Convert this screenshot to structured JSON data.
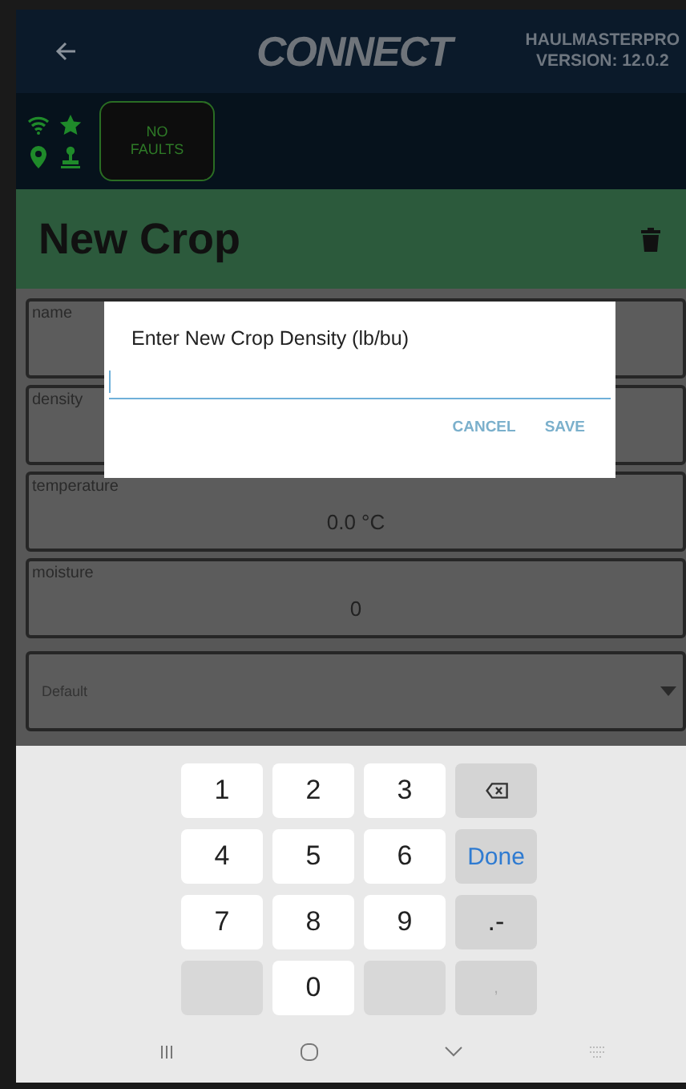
{
  "header": {
    "logo": "CONNECT",
    "app_name": "HAULMASTERPRO",
    "version": "VERSION: 12.0.2"
  },
  "status": {
    "faults": "NO FAULTS"
  },
  "page_title": "New Crop",
  "fields": [
    {
      "label": "name"
    },
    {
      "label": "density"
    },
    {
      "label": "temperature",
      "value": "0.0 °C"
    },
    {
      "label": "moisture",
      "value": "0"
    }
  ],
  "dropdown": {
    "value": "Default"
  },
  "dialog": {
    "title": "Enter New Crop Density (lb/bu)",
    "buttons": [
      "CANCEL",
      "SAVE"
    ]
  },
  "keyboard": {
    "rows": [
      [
        {
          "kind": "digit",
          "label": "1"
        },
        {
          "kind": "digit",
          "label": "2"
        },
        {
          "kind": "digit",
          "label": "3"
        },
        {
          "kind": "backspace"
        }
      ],
      [
        {
          "kind": "digit",
          "label": "4"
        },
        {
          "kind": "digit",
          "label": "5"
        },
        {
          "kind": "digit",
          "label": "6"
        },
        {
          "kind": "done",
          "label": "Done"
        }
      ],
      [
        {
          "kind": "digit",
          "label": "7"
        },
        {
          "kind": "digit",
          "label": "8"
        },
        {
          "kind": "digit",
          "label": "9"
        },
        {
          "kind": "symbol",
          "label": ".-"
        }
      ],
      [
        {
          "kind": "blank"
        },
        {
          "kind": "digit",
          "label": "0"
        },
        {
          "kind": "blank"
        },
        {
          "kind": "inactive",
          "label": ","
        }
      ]
    ]
  }
}
